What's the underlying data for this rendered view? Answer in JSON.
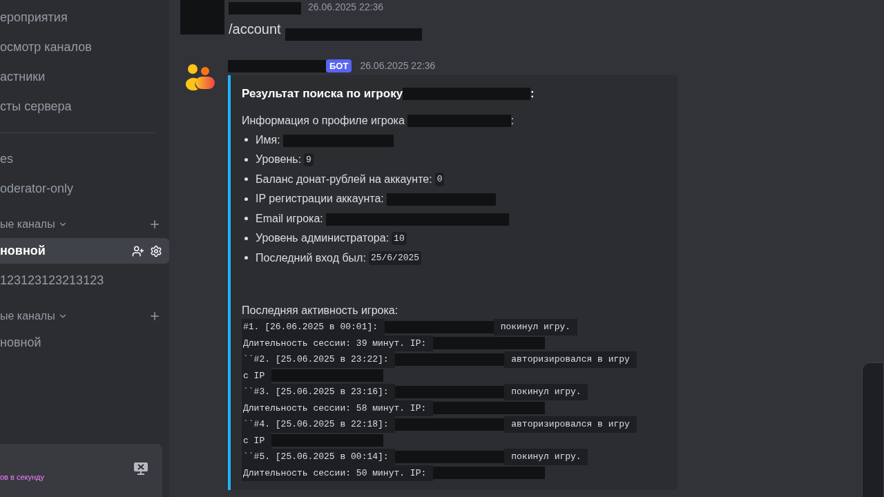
{
  "sidebar": {
    "items": [
      {
        "kind": "channel",
        "label": "ероприятия",
        "selected": false
      },
      {
        "kind": "channel",
        "label": "осмотр каналов",
        "selected": false
      },
      {
        "kind": "channel",
        "label": "астники",
        "selected": false
      },
      {
        "kind": "channel",
        "label": "сты сервера",
        "selected": false
      },
      {
        "kind": "divider"
      },
      {
        "kind": "channel",
        "label": "es",
        "selected": false
      },
      {
        "kind": "channel",
        "label": "oderator-only",
        "selected": false
      },
      {
        "kind": "category",
        "label": "ые каналы"
      },
      {
        "kind": "channel",
        "label": "новной",
        "selected": true
      },
      {
        "kind": "channel",
        "label": "123123123213123",
        "selected": false
      },
      {
        "kind": "category",
        "label": "ые каналы"
      },
      {
        "kind": "channel",
        "label": "новной",
        "selected": false
      }
    ],
    "panel": {
      "text": "ов в секунду"
    }
  },
  "messages": [
    {
      "timestamp": "26.06.2025 22:36",
      "text": "/account"
    },
    {
      "badge": "БОТ",
      "timestamp": "26.06.2025 22:36",
      "embed": {
        "title": "Результат поиска по игроку",
        "title_suffix": ":",
        "intro": "Информация о профиле игрока",
        "intro_suffix": ":",
        "fields": [
          {
            "label": "Имя:",
            "redacted": true
          },
          {
            "label": "Уровень:",
            "code": "9"
          },
          {
            "label": "Баланс донат-рублей на аккаунте:",
            "code": "0"
          },
          {
            "label": "IP регистрации аккаунта:",
            "redacted": true
          },
          {
            "label": "Email игрока:",
            "redacted": true
          },
          {
            "label": "Уровень администратора:",
            "code": "10"
          },
          {
            "label": "Последний вход был:",
            "code": "25/6/2025"
          }
        ],
        "activity_title": "Последняя активность игрока:",
        "activity": [
          [
            {
              "kind": "code",
              "text": "#1. [26.06.2025 в 00:01]: "
            },
            {
              "kind": "redacted"
            },
            {
              "kind": "code",
              "text": " покинул игру. "
            }
          ],
          [
            {
              "kind": "code",
              "text": "Длительность сессии: 39 минут. IP: "
            },
            {
              "kind": "redacted"
            }
          ],
          [
            {
              "kind": "code",
              "text": "``#2. [25.06.2025 в 23:22]: "
            },
            {
              "kind": "redacted"
            },
            {
              "kind": "code",
              "text": " авторизировался в игру "
            }
          ],
          [
            {
              "kind": "code",
              "text": "с IP "
            },
            {
              "kind": "redacted"
            }
          ],
          [
            {
              "kind": "code",
              "text": "``#3. [25.06.2025 в 23:16]: "
            },
            {
              "kind": "redacted"
            },
            {
              "kind": "code",
              "text": " покинул игру. "
            }
          ],
          [
            {
              "kind": "code",
              "text": "Длительность сессии: 58 минут. IP: "
            },
            {
              "kind": "redacted"
            }
          ],
          [
            {
              "kind": "code",
              "text": "``#4. [25.06.2025 в 22:18]: "
            },
            {
              "kind": "redacted"
            },
            {
              "kind": "code",
              "text": " авторизировался в игру "
            }
          ],
          [
            {
              "kind": "code",
              "text": "с IP "
            },
            {
              "kind": "redacted"
            }
          ],
          [
            {
              "kind": "code",
              "text": "``#5. [25.06.2025 в 00:14]: "
            },
            {
              "kind": "redacted"
            },
            {
              "kind": "code",
              "text": " покинул игру. "
            }
          ],
          [
            {
              "kind": "code",
              "text": "Длительность сессии: 50 минут. IP: "
            },
            {
              "kind": "redacted"
            }
          ]
        ]
      }
    }
  ]
}
